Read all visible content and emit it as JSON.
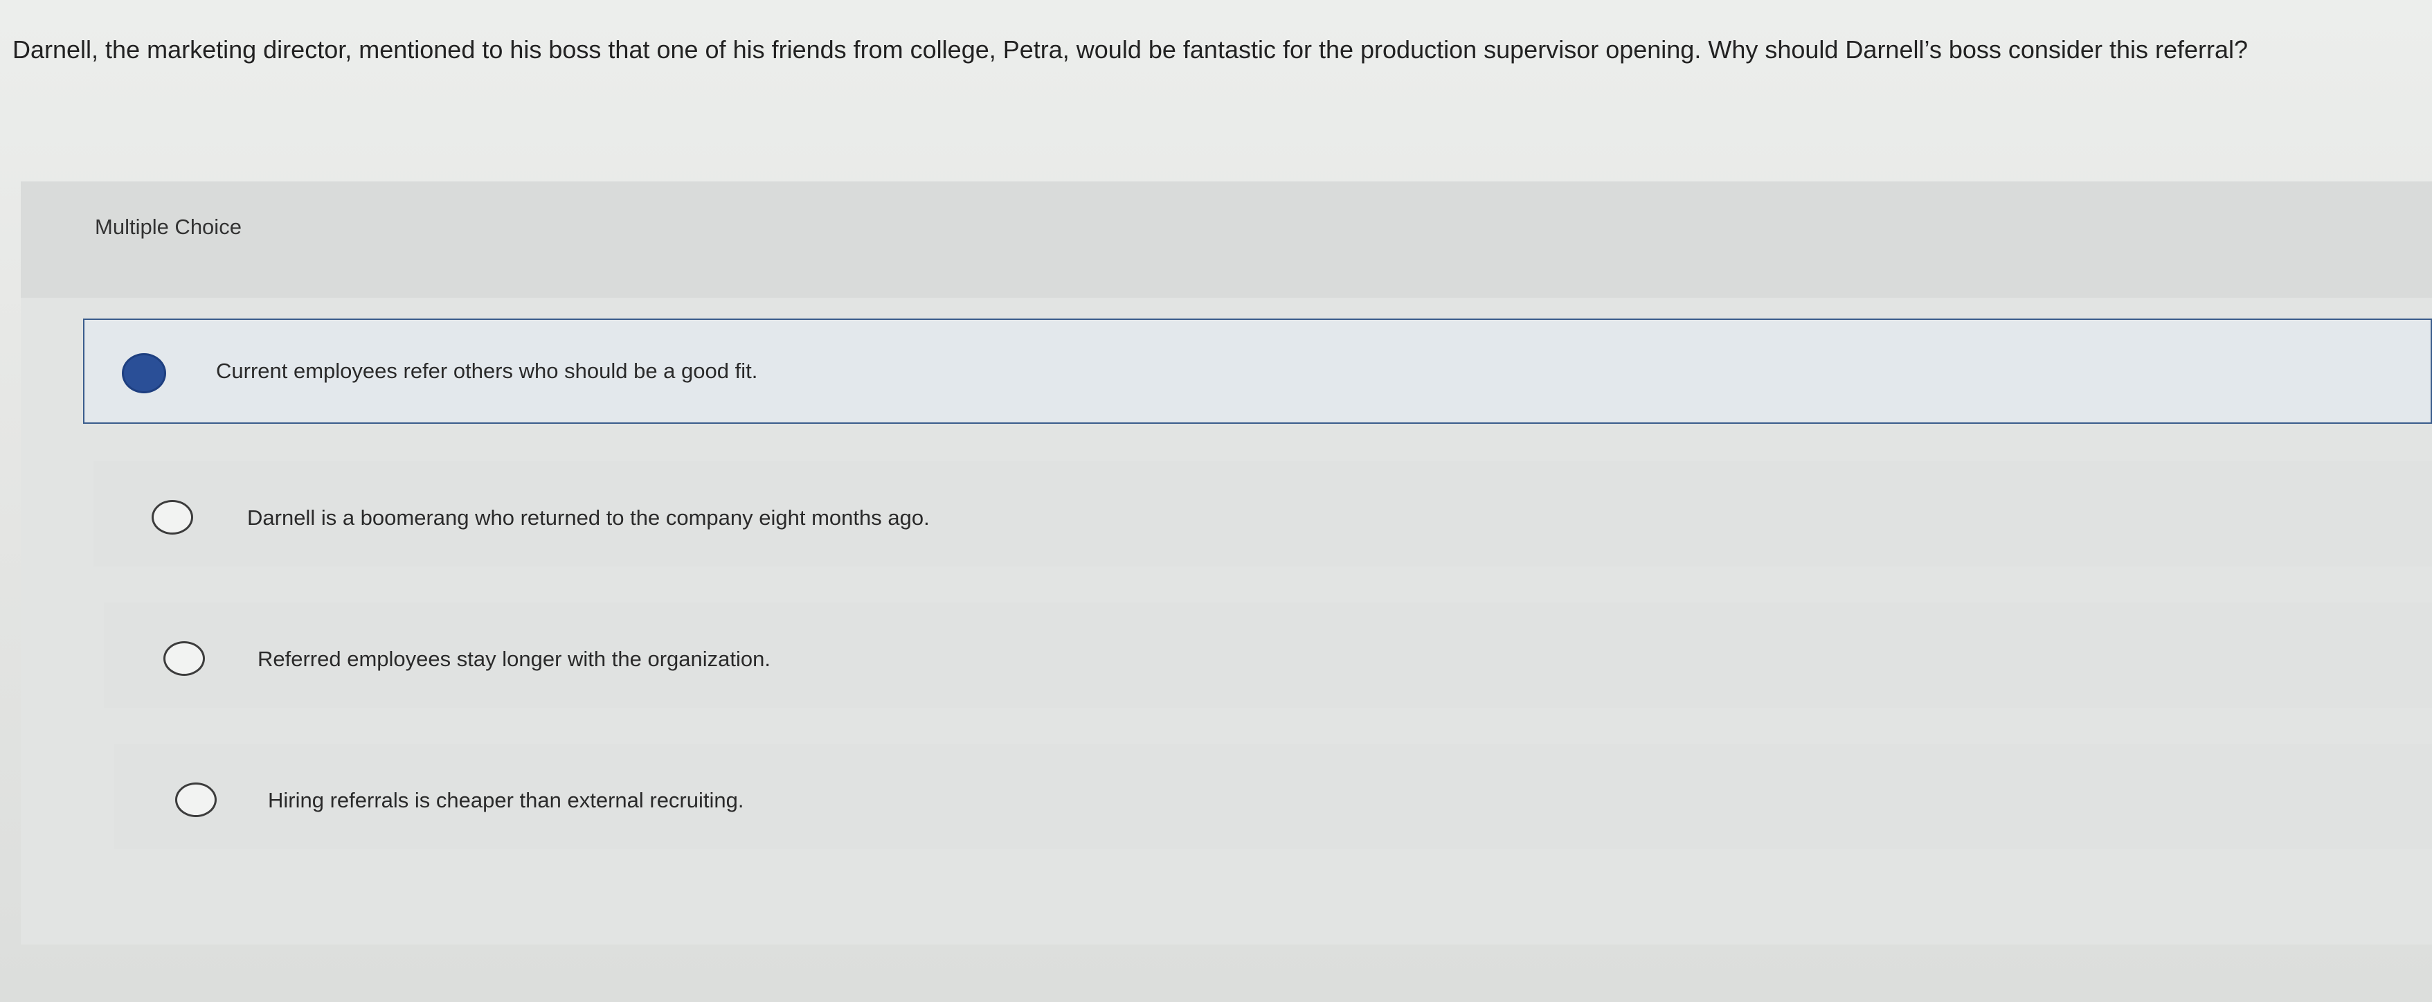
{
  "question": {
    "text": "Darnell, the marketing director, mentioned to his boss that one of his friends from college, Petra, would be fantastic for the production supervisor opening. Why should Darnell’s boss consider this referral?"
  },
  "panel": {
    "type_label": "Multiple Choice"
  },
  "options": [
    {
      "label": "Current employees refer others who should be a good fit.",
      "selected": true
    },
    {
      "label": "Darnell is a boomerang who returned to the company eight months ago.",
      "selected": false
    },
    {
      "label": "Referred employees stay longer with the organization.",
      "selected": false
    },
    {
      "label": "Hiring referrals is cheaper than external recruiting.",
      "selected": false
    }
  ],
  "colors": {
    "selected_radio": "#2a4f97",
    "selected_border": "#3a5c8c",
    "text": "#222222"
  }
}
